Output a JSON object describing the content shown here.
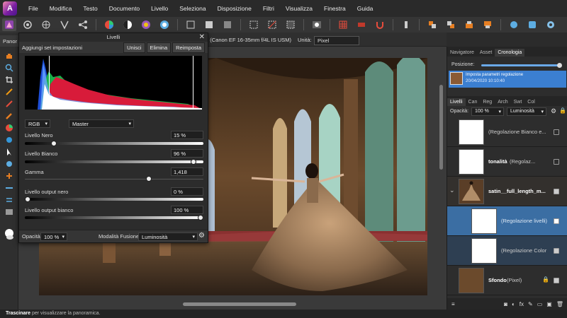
{
  "menu": [
    "File",
    "Modifica",
    "Testo",
    "Documento",
    "Livello",
    "Seleziona",
    "Disposizione",
    "Filtri",
    "Visualizza",
    "Finestra",
    "Guida"
  ],
  "app_icon_letter": "A",
  "context": {
    "tab_label": "Panor",
    "lens": "5 (Canon EF 16-35mm f/4L IS USM)",
    "unit_label": "Unità:",
    "unit_value": "Pixel"
  },
  "levels": {
    "title": "Livelli",
    "preset": "Aggiungi set impostazioni",
    "buttons": {
      "merge": "Unisci",
      "delete": "Elimina",
      "reset": "Reimposta"
    },
    "channel": "RGB",
    "mode": "Master",
    "black_label": "Livello Nero",
    "black_value": "15 %",
    "white_label": "Livello Bianco",
    "white_value": "96 %",
    "gamma_label": "Gamma",
    "gamma_value": "1,418",
    "out_black_label": "Livello output nero",
    "out_black_value": "0 %",
    "out_white_label": "Livello output bianco",
    "out_white_value": "100 %",
    "opacity_label": "Opacità:",
    "opacity_value": "100 %",
    "blend_label": "Modalità Fusione:",
    "blend_value": "Luminosità",
    "black_level": 0.15,
    "white_level": 0.96,
    "gamma_level": 0.7,
    "out_black_level": 0.0,
    "out_white_level": 1.0
  },
  "panels": {
    "top_tabs": [
      "Navigatore",
      "Asset",
      "Cronologia"
    ],
    "position_label": "Posizione:",
    "history_text": "Imposta parametri regolazione",
    "history_date": "20/04/2020 10:10:40",
    "layer_tabs": [
      "Livelli",
      "Can",
      "Reg",
      "Arch",
      "Swt",
      "Col"
    ],
    "opacity_label": "Opacità:",
    "opacity_value": "100 %",
    "blend_value": "Luminosità",
    "layers": [
      {
        "name": "(Regolazione Bianco e...",
        "bold": false
      },
      {
        "name": "tonalità",
        "suffix": "(Regolaz...",
        "bold": true
      },
      {
        "name": "satin__full_length_m...",
        "bold": true
      },
      {
        "name": "(Regolazione livelli)",
        "bold": false
      },
      {
        "name": "(Regolazione Color",
        "bold": false
      },
      {
        "name": "Sfondo",
        "suffix": "(Pixel)",
        "bold": true
      }
    ]
  },
  "status": {
    "bold": "Trascinare",
    "text": " per visualizzare la panoramica."
  }
}
